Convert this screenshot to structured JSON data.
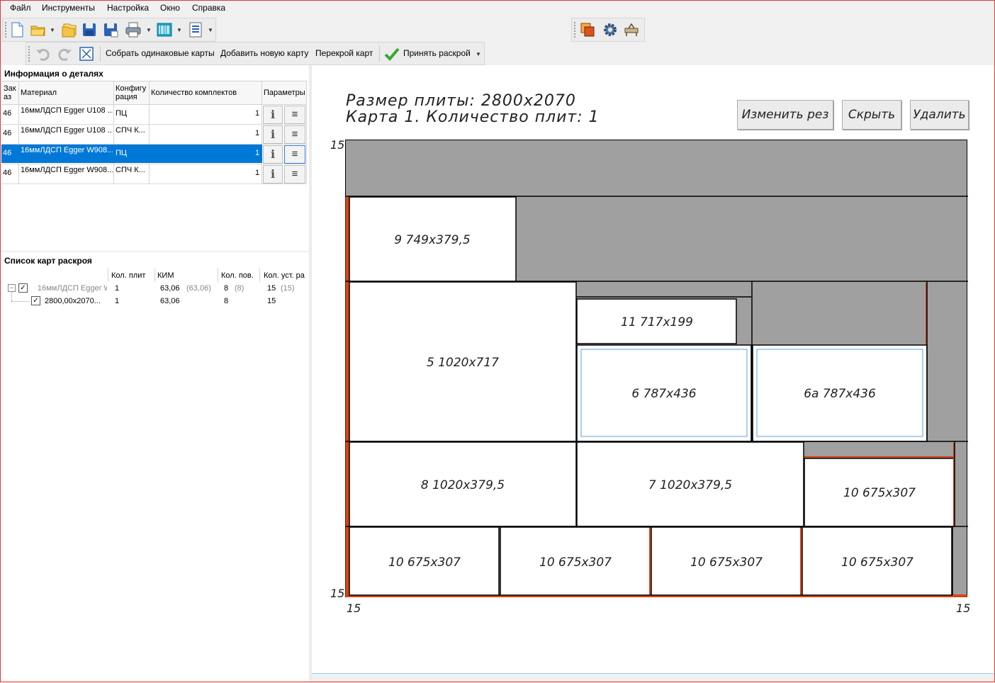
{
  "menu": [
    "Файл",
    "Инструменты",
    "Настройка",
    "Окно",
    "Справка"
  ],
  "toolbar": {
    "collect_label": "Собрать одинаковые карты",
    "add_label": "Добавить новую карту",
    "reorder_label": "Перекрой карт",
    "accept_label": "Принять раскрой"
  },
  "details": {
    "title": "Информация о деталях",
    "headers": {
      "order": "Зак\nаз",
      "material": "Материал",
      "config": "Конфигу\nрация",
      "qty": "Количество комплектов",
      "params": "Параметры"
    },
    "rows": [
      {
        "order": "46",
        "material": "16ммЛДСП Egger U108 ...",
        "config": "ПЦ",
        "qty": "1"
      },
      {
        "order": "46",
        "material": "16ммЛДСП Egger U108 ...",
        "config": "СПЧ К...",
        "qty": "1"
      },
      {
        "order": "46",
        "material": "16ммЛДСП Egger W908...",
        "config": "ПЦ",
        "qty": "1"
      },
      {
        "order": "46",
        "material": "16ммЛДСП Egger W908...",
        "config": "СПЧ К...",
        "qty": "1"
      }
    ],
    "selected_row": 2
  },
  "maps": {
    "title": "Список карт раскроя",
    "headers": {
      "sheets": "Кол. плит",
      "kim": "КИМ",
      "turns": "Кол. пов.",
      "setups": "Кол. уст. ра"
    },
    "group": {
      "name": "16ммЛДСП Egger W9",
      "sheets": "1",
      "kim": "63,06",
      "kim_sub": "(63,06)",
      "turns": "8",
      "turns_sub": "(8)",
      "setups": "15",
      "setups_sub": "(15)"
    },
    "item": {
      "name": "2800,00x2070...",
      "sheets": "1",
      "kim": "63,06",
      "turns": "8",
      "setups": "15"
    }
  },
  "drawing": {
    "line1": "Размер плиты: 2800x2070",
    "line2": "Карта 1. Количество плит: 1",
    "buttons": {
      "change": "Изменить рез",
      "hide": "Скрыть",
      "delete": "Удалить"
    },
    "margin_top": "15",
    "margin_left_bottom": "15",
    "margin_bottom_left": "15",
    "margin_bottom_right": "15",
    "parts": [
      "9 749x379,5",
      "11 717x199",
      "5 1020x717",
      "6 787x436",
      "6а 787x436",
      "8 1020x379,5",
      "7 1020x379,5",
      "10 675x307",
      "10 675x307",
      "10 675x307",
      "10 675x307",
      "10 675x307"
    ],
    "colors": {
      "waste": "#a0a0a0",
      "edge": "#d84315",
      "part": "#ffffff",
      "selected_part_border": "#5aa0e0"
    }
  }
}
